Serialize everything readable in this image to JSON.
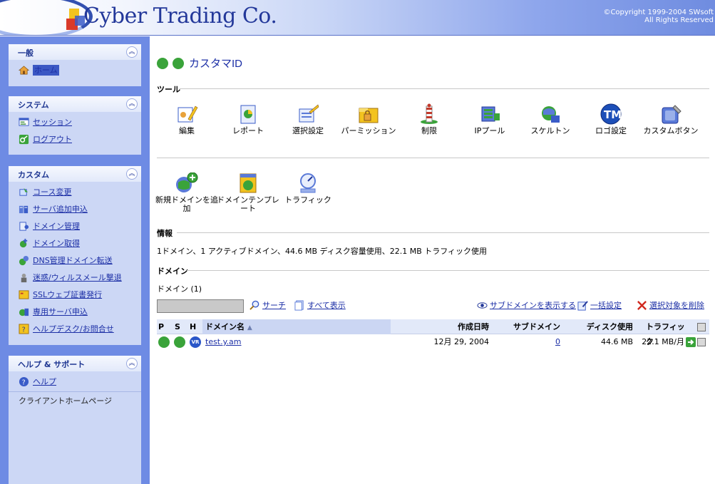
{
  "header": {
    "logo_text": "Cyber Trading Co.",
    "copyright_line1": "©Copyright 1999-2004 SWsoft",
    "copyright_line2": "All Rights Reserved"
  },
  "sidebar": {
    "general": {
      "title": "一般",
      "items": [
        {
          "label": "ホーム",
          "icon": "home-icon"
        }
      ]
    },
    "system": {
      "title": "システム",
      "items": [
        {
          "label": "セッション",
          "icon": "session-icon"
        },
        {
          "label": "ログアウト",
          "icon": "logout-icon"
        }
      ]
    },
    "custom": {
      "title": "カスタム",
      "items": [
        {
          "label": "コース変更",
          "icon": "plan-change-icon"
        },
        {
          "label": "サーバ追加申込",
          "icon": "server-add-icon"
        },
        {
          "label": "ドメイン管理",
          "icon": "domain-manage-icon"
        },
        {
          "label": "ドメイン取得",
          "icon": "domain-register-icon"
        },
        {
          "label": "DNS管理ドメイン転送",
          "icon": "dns-icon"
        },
        {
          "label": "迷惑/ウィルスメール撃退",
          "icon": "spam-icon"
        },
        {
          "label": "SSLウェブ証書発行",
          "icon": "ssl-icon"
        },
        {
          "label": "専用サーバ申込",
          "icon": "dedicated-server-icon"
        },
        {
          "label": "ヘルプデスク/お問合せ",
          "icon": "helpdesk-icon"
        }
      ]
    },
    "help": {
      "title": "ヘルプ & サポート",
      "items": [
        {
          "label": "ヘルプ",
          "icon": "help-icon"
        },
        {
          "label": "クライアントホームページ"
        }
      ]
    }
  },
  "main": {
    "title": "カスタマID",
    "tools_heading": "ツール",
    "tools": [
      {
        "label": "編集",
        "icon": "edit-icon"
      },
      {
        "label": "レポート",
        "icon": "report-icon"
      },
      {
        "label": "選択設定",
        "icon": "preferences-icon"
      },
      {
        "label": "パーミッション",
        "icon": "permissions-icon"
      },
      {
        "label": "制限",
        "icon": "limits-icon"
      },
      {
        "label": "IPプール",
        "icon": "ip-pool-icon"
      },
      {
        "label": "スケルトン",
        "icon": "skeleton-icon"
      },
      {
        "label": "ロゴ設定",
        "icon": "logo-setup-icon"
      },
      {
        "label": "カスタムボタン",
        "icon": "custom-buttons-icon"
      }
    ],
    "tools2": [
      {
        "label": "新規ドメインを追加",
        "icon": "add-domain-icon"
      },
      {
        "label": "ドメインテンプレート",
        "icon": "domain-template-icon"
      },
      {
        "label": "トラフィック",
        "icon": "traffic-icon"
      }
    ],
    "info_heading": "情報",
    "info_text": "1ドメイン、1 アクティブドメイン、44.6 MB ディスク容量使用、22.1 MB トラフィック使用",
    "domains_heading": "ドメイン",
    "domain_count": "ドメイン (1)",
    "search_value": "",
    "search_label": "サーチ",
    "show_all_label": "すべて表示",
    "show_subdomains_label": "サブドメインを表示する",
    "group_ops_label": "一括設定",
    "remove_selected_label": "選択対象を削除",
    "table": {
      "headers": {
        "p": "P",
        "s": "S",
        "h": "H",
        "name": "ドメイン名",
        "created": "作成日時",
        "subdomains": "サブドメイン",
        "disk": "ディスク使用",
        "traffic": "トラフィック"
      },
      "rows": [
        {
          "name": "test.y.am",
          "created": "12月 29, 2004",
          "subdomains": "0",
          "disk": "44.6 MB",
          "traffic": "22.1 MB/月"
        }
      ]
    }
  },
  "colors": {
    "sidebar_bg": "#6e8be4",
    "link": "#1c2fa6",
    "ok_green": "#3aa33a",
    "header_text": "#23389a"
  }
}
